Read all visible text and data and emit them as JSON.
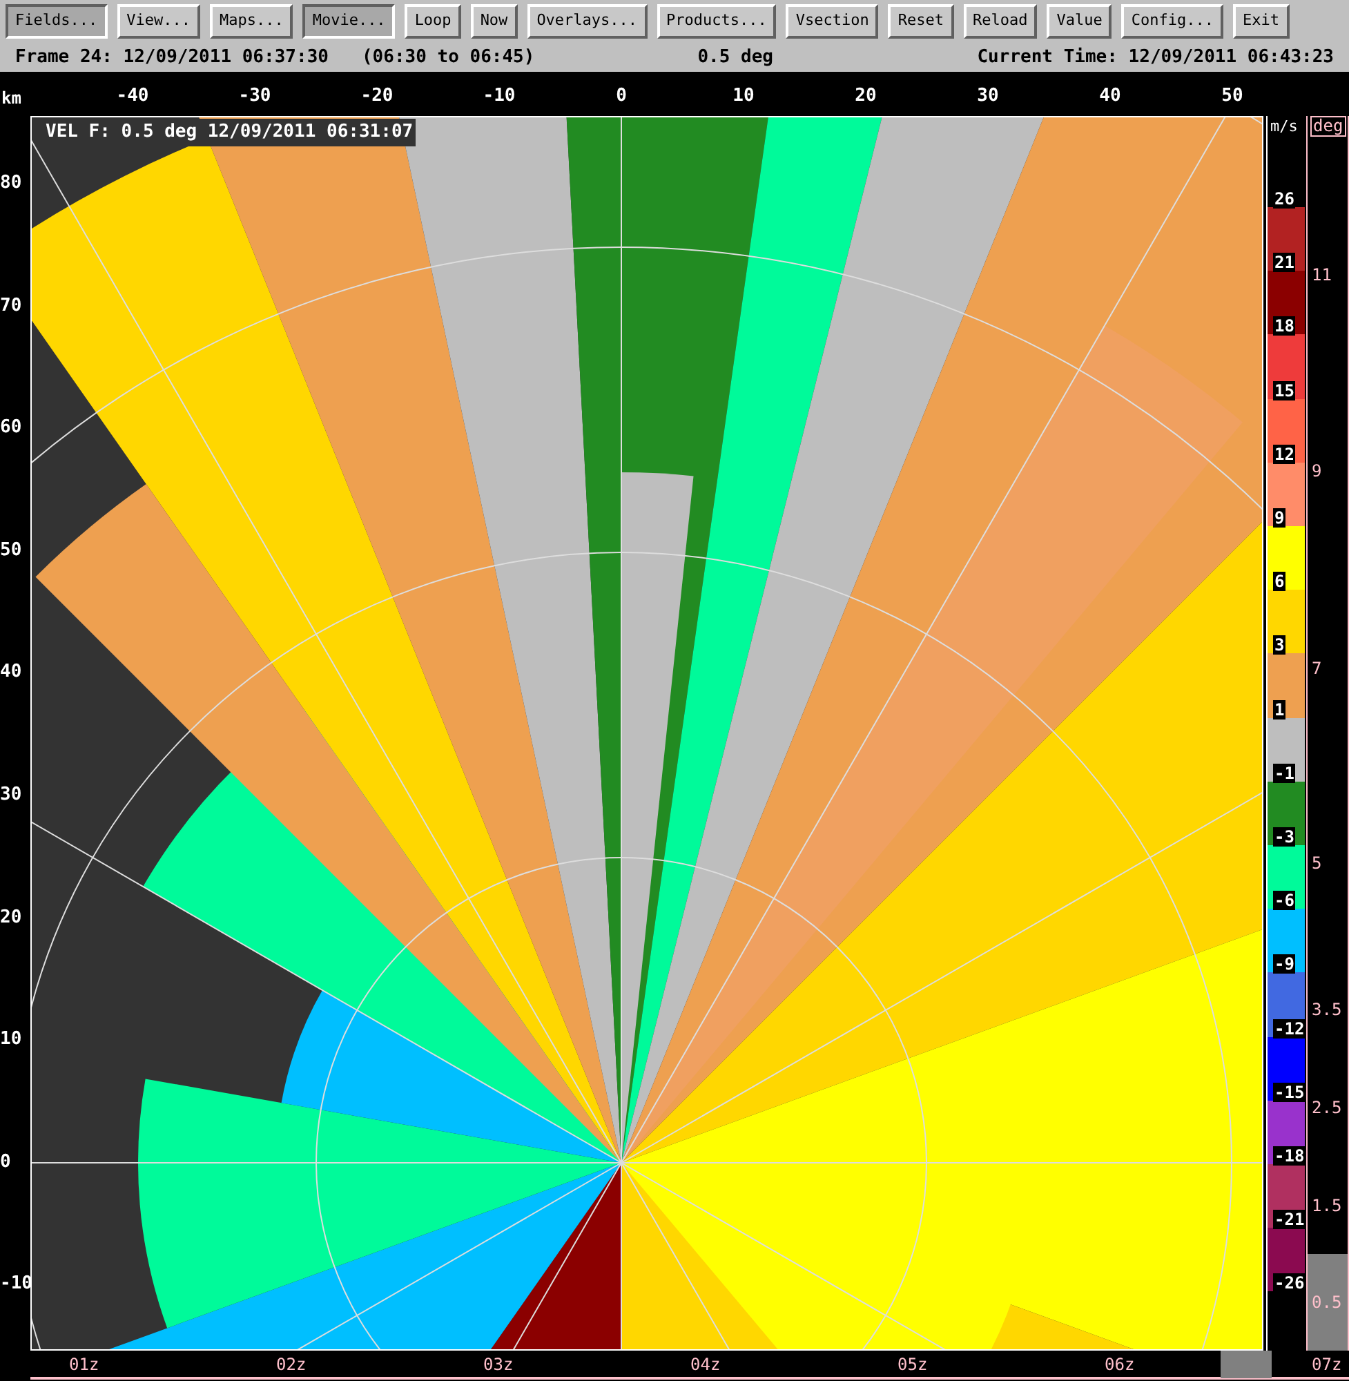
{
  "toolbar": {
    "buttons": [
      {
        "label": "Fields...",
        "selected": true
      },
      {
        "label": "View...",
        "selected": false
      },
      {
        "label": "Maps...",
        "selected": false
      },
      {
        "label": "Movie...",
        "selected": true
      },
      {
        "label": "Loop",
        "selected": false
      },
      {
        "label": "Now",
        "selected": false
      },
      {
        "label": "Overlays...",
        "selected": false
      },
      {
        "label": "Products...",
        "selected": false
      },
      {
        "label": "Vsection",
        "selected": false
      },
      {
        "label": "Reset",
        "selected": false
      },
      {
        "label": "Reload",
        "selected": false
      },
      {
        "label": "Value",
        "selected": false
      },
      {
        "label": "Config...",
        "selected": false
      },
      {
        "label": "Exit",
        "selected": false
      }
    ]
  },
  "header": {
    "frame": "Frame 24: 12/09/2011 06:37:30",
    "range": "(06:30 to 06:45)",
    "elevation": "0.5 deg",
    "current_time": "Current Time: 12/09/2011 06:43:23"
  },
  "plot": {
    "overlay_label": "VEL F: 0.5 deg 12/09/2011 06:31:07",
    "unit": "km",
    "x_ticks": [
      "-40",
      "-30",
      "-20",
      "-10",
      "0",
      "10",
      "20",
      "30",
      "40",
      "50"
    ],
    "y_ticks": [
      "80",
      "70",
      "60",
      "50",
      "40",
      "30",
      "20",
      "10",
      "0",
      "-10"
    ]
  },
  "color_scale": {
    "unit": "m/s",
    "labels": [
      "26",
      "21",
      "18",
      "15",
      "12",
      "9",
      "6",
      "3",
      "1",
      "-1",
      "-3",
      "-6",
      "-9",
      "-12",
      "-15",
      "-18",
      "-21",
      "-26"
    ],
    "bands": [
      {
        "color": "#b22222"
      },
      {
        "color": "#8b0000"
      },
      {
        "color": "#ee3b3b"
      },
      {
        "color": "#ff6347"
      },
      {
        "color": "#ff8c69"
      },
      {
        "color": "#ffff00"
      },
      {
        "color": "#ffd700"
      },
      {
        "color": "#eea050"
      },
      {
        "color": "#bebebe"
      },
      {
        "color": "#228b22"
      },
      {
        "color": "#00fa9a"
      },
      {
        "color": "#00bfff"
      },
      {
        "color": "#4169e1"
      },
      {
        "color": "#0000ff"
      },
      {
        "color": "#9932cc"
      },
      {
        "color": "#b03060"
      },
      {
        "color": "#8b0a50"
      }
    ]
  },
  "elevation_scale": {
    "unit": "deg",
    "ticks": [
      "11",
      "9",
      "7",
      "5",
      "3.5",
      "2.5",
      "1.5",
      "0.5"
    ]
  },
  "timeline": {
    "ticks": [
      "01z",
      "02z",
      "03z",
      "04z",
      "05z",
      "06z",
      "07z"
    ]
  }
}
